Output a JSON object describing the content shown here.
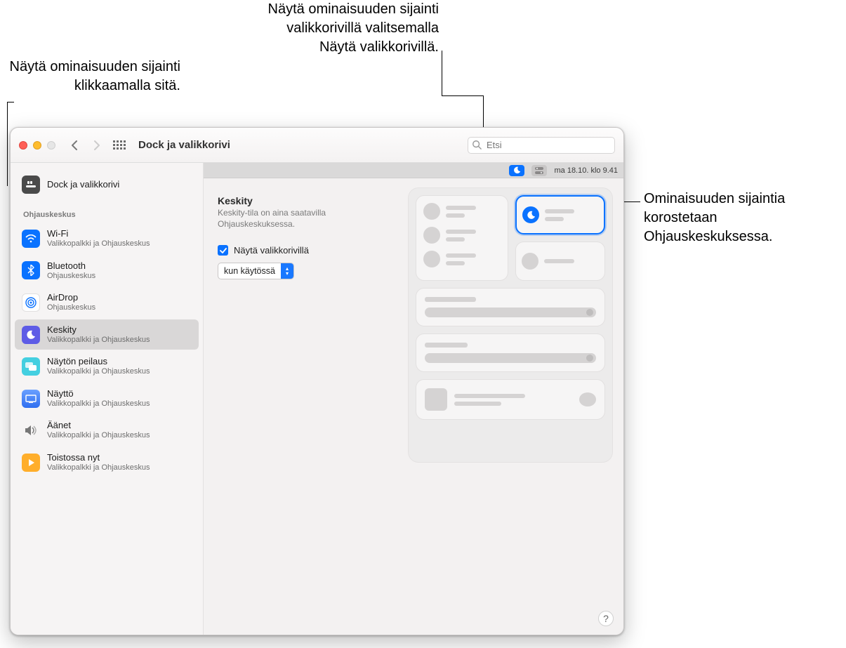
{
  "callouts": {
    "topLeft": "Näytä ominaisuuden sijainti klikkaamalla sitä.",
    "topMid": "Näytä ominaisuuden sijainti valikkorivillä valitsemalla Näytä valikkorivillä.",
    "right": "Ominaisuuden sijaintia korostetaan Ohjauskeskuksessa."
  },
  "window": {
    "title": "Dock ja valikkorivi",
    "searchPlaceholder": "Etsi"
  },
  "sidebar": {
    "topItem": {
      "title": "Dock ja valikkorivi",
      "sub": ""
    },
    "heading": "Ohjauskeskus",
    "items": [
      {
        "title": "Wi-Fi",
        "sub": "Valikkopalkki ja Ohjauskeskus"
      },
      {
        "title": "Bluetooth",
        "sub": "Ohjauskeskus"
      },
      {
        "title": "AirDrop",
        "sub": "Ohjauskeskus"
      },
      {
        "title": "Keskity",
        "sub": "Valikkopalkki ja Ohjauskeskus"
      },
      {
        "title": "Näytön peilaus",
        "sub": "Valikkopalkki ja Ohjauskeskus"
      },
      {
        "title": "Näyttö",
        "sub": "Valikkopalkki ja Ohjauskeskus"
      },
      {
        "title": "Äänet",
        "sub": "Valikkopalkki ja Ohjauskeskus"
      },
      {
        "title": "Toistossa nyt",
        "sub": "Valikkopalkki ja Ohjauskeskus"
      }
    ]
  },
  "detail": {
    "menuDate": "ma 18.10. klo  9.41",
    "heading": "Keskity",
    "sub": "Keskity-tila on aina saatavilla Ohjauskeskuksessa.",
    "checkboxLabel": "Näytä valikkorivillä",
    "selectValue": "kun käytössä"
  },
  "help": "?"
}
